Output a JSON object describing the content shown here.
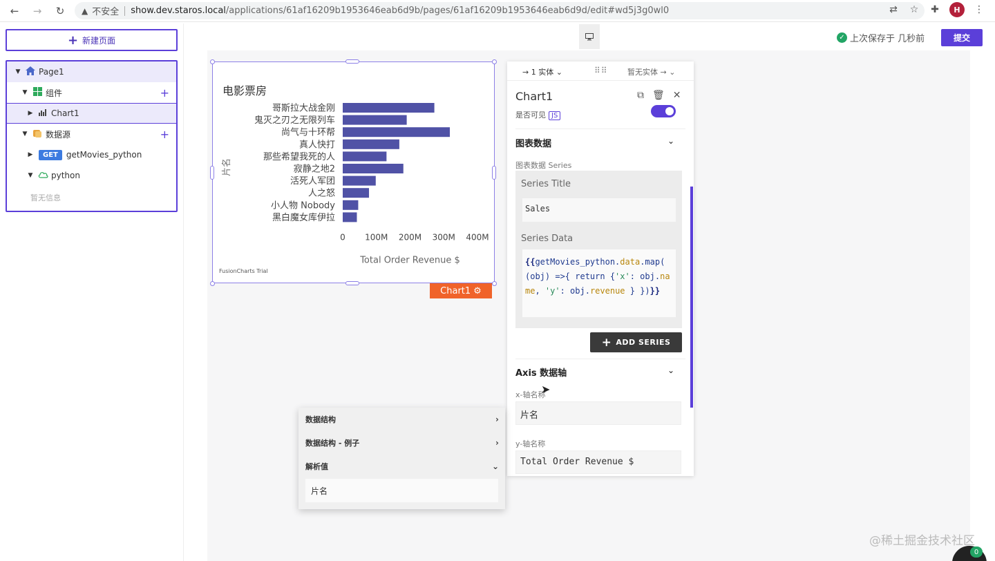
{
  "browser": {
    "insecure_label": "不安全",
    "url_host": "show.dev.staros.local",
    "url_path": "/applications/61af16209b1953646eab6d9b/pages/61af16209b1953646eab6d9d/edit#wd5j3g0wl0",
    "avatar_initial": "H"
  },
  "topbar": {
    "save_status": "上次保存于 几秒前",
    "submit_label": "提交"
  },
  "sidebar": {
    "new_page_label": "新建页面",
    "tree": {
      "page": "Page1",
      "components": "组件",
      "chart": "Chart1",
      "datasources": "数据源",
      "query_method": "GET",
      "query_name": "getMovies_python",
      "datasource": "python",
      "empty": "暂无信息"
    }
  },
  "chart_data": {
    "type": "bar",
    "orientation": "horizontal",
    "title": "电影票房",
    "xlabel": "Total Order Revenue $",
    "ylabel": "片名",
    "categories": [
      "哥斯拉大战金刚",
      "鬼灭之刃之无限列车",
      "尚气与十环帮",
      "真人快打",
      "那些希望我死的人",
      "寂静之地2",
      "活死人军团",
      "人之怒",
      "小人物 Nobody",
      "黑白魔女库伊拉"
    ],
    "values": [
      272,
      190,
      318,
      168,
      130,
      180,
      98,
      78,
      46,
      42
    ],
    "unit": "M",
    "xlim": [
      0,
      400
    ],
    "xticks": [
      "0",
      "100M",
      "200M",
      "300M",
      "400M"
    ],
    "bar_color": "#5052a6",
    "watermark": "FusionCharts Trial",
    "grid": false
  },
  "widget": {
    "tag_label": "Chart1"
  },
  "property_pane": {
    "entity_label": "1 实体",
    "no_entity_label": "暂无实体",
    "widget_name": "Chart1",
    "visible_label": "是否可见",
    "js_chip": "JS",
    "visible_on": true,
    "chart_section": "图表数据",
    "series_section_label": "图表数据 Series",
    "series_title_label": "Series Title",
    "series_title_value": "Sales",
    "series_data_label": "Series Data",
    "add_series_label": "ADD SERIES",
    "axis_section": "Axis 数据轴",
    "x_axis_label": "x-轴名称",
    "x_axis_value": "片名",
    "y_axis_label": "y-轴名称",
    "y_axis_value": "Total Order Revenue $"
  },
  "eval_pane": {
    "data_structure": "数据结构",
    "data_structure_example": "数据结构 - 例子",
    "evaluated_value": "解析值",
    "value": "片名"
  },
  "watermark": "@稀土掘金技术社区",
  "notification_count": "0"
}
